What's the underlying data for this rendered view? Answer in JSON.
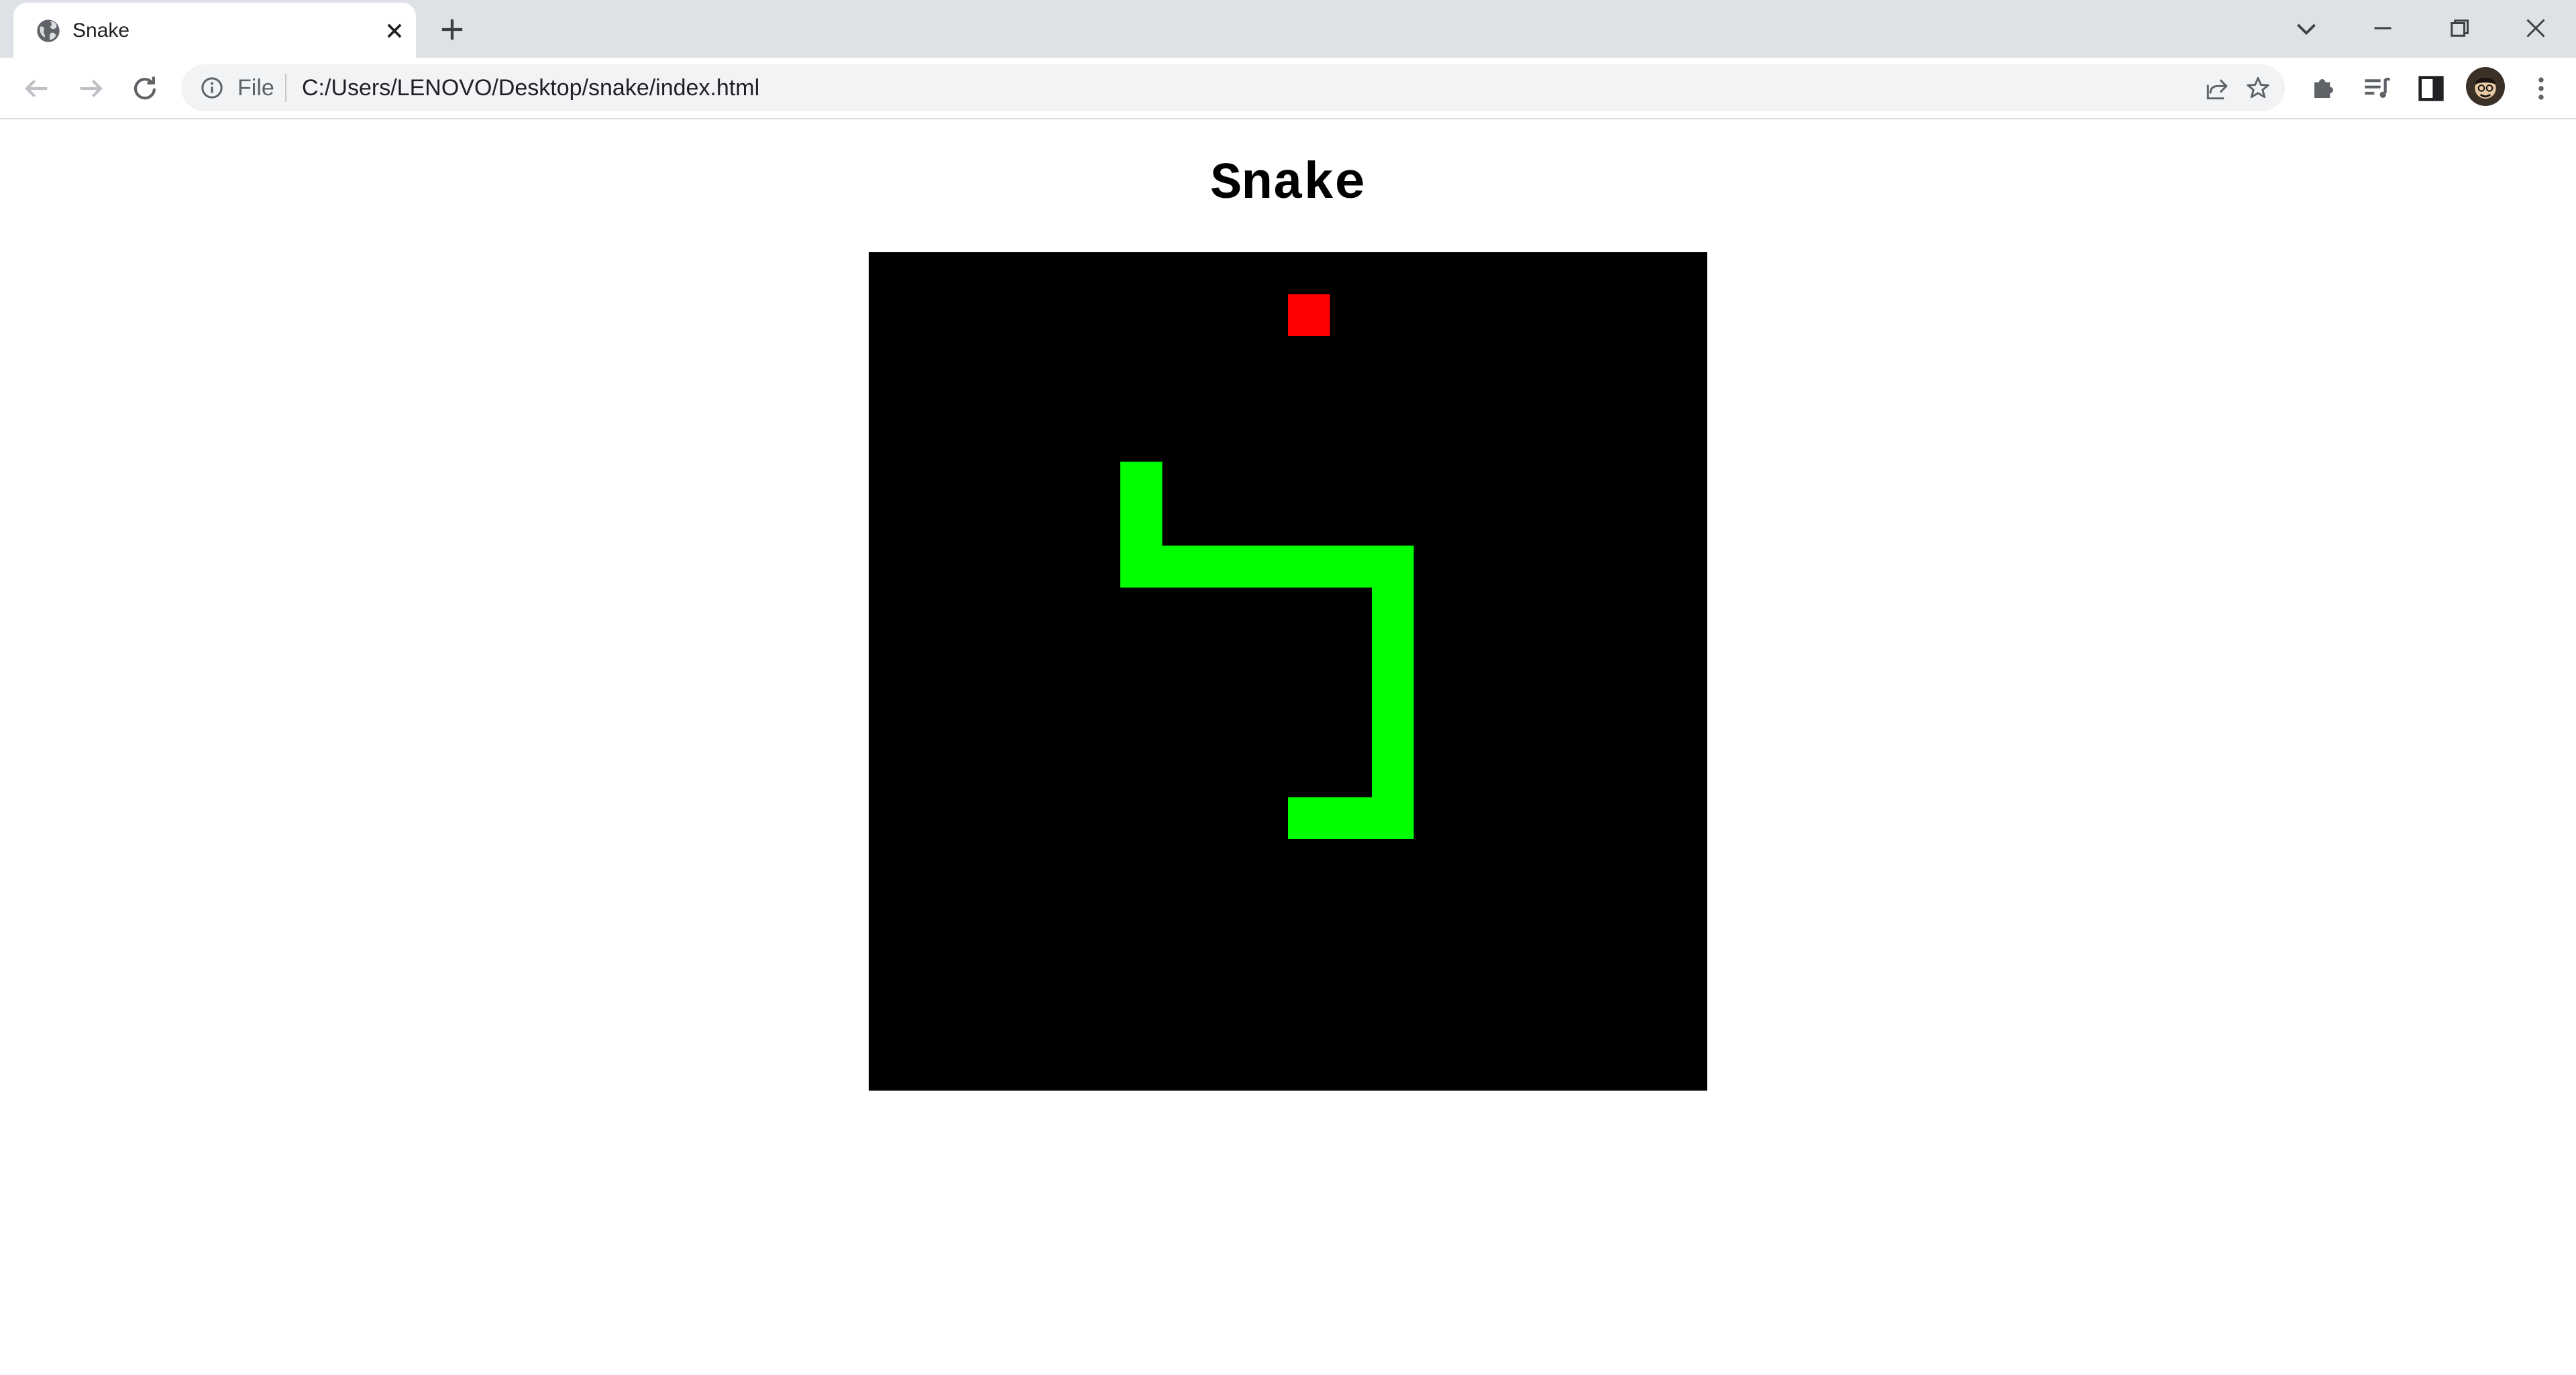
{
  "browser": {
    "tab": {
      "title": "Snake",
      "favicon": "globe-icon",
      "close_icon": "close-icon"
    },
    "new_tab_icon": "plus-icon",
    "window_controls": [
      "chevron-down-icon",
      "minimize-icon",
      "restore-icon",
      "close-icon"
    ],
    "nav": [
      "back-arrow-icon",
      "forward-arrow-icon",
      "reload-icon"
    ],
    "address_bar": {
      "info_icon": "info-icon",
      "scheme": "File",
      "url": "C:/Users/LENOVO/Desktop/snake/index.html",
      "actions": [
        "share-icon",
        "star-icon"
      ]
    },
    "toolbar_icons": [
      "extensions-icon",
      "reading-list-icon",
      "side-panel-icon",
      "profile-avatar",
      "more-vert-icon"
    ]
  },
  "page": {
    "title": "Snake"
  },
  "game": {
    "grid_cells": 20,
    "colors": {
      "background": "#000000",
      "snake": "#00ff00",
      "food": "#ff0000"
    },
    "food": [
      10,
      1
    ],
    "snake": [
      [
        6,
        5
      ],
      [
        6,
        6
      ],
      [
        6,
        7
      ],
      [
        7,
        7
      ],
      [
        8,
        7
      ],
      [
        9,
        7
      ],
      [
        10,
        7
      ],
      [
        11,
        7
      ],
      [
        12,
        7
      ],
      [
        12,
        8
      ],
      [
        12,
        9
      ],
      [
        12,
        10
      ],
      [
        12,
        11
      ],
      [
        12,
        12
      ],
      [
        12,
        13
      ],
      [
        11,
        13
      ],
      [
        10,
        13
      ]
    ]
  }
}
